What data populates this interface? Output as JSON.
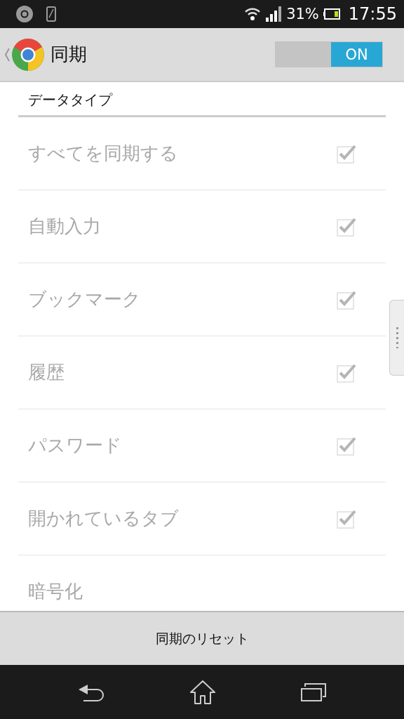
{
  "status_bar": {
    "battery_percent": "31%",
    "time": "17:55"
  },
  "action_bar": {
    "title": "同期",
    "toggle": {
      "label": "ON",
      "on": true
    }
  },
  "section_header": "データタイプ",
  "items": [
    {
      "kind": "checkbox",
      "label": "すべてを同期する",
      "checked": true,
      "disabled": true
    },
    {
      "kind": "checkbox",
      "label": "自動入力",
      "checked": true,
      "disabled": true
    },
    {
      "kind": "checkbox",
      "label": "ブックマーク",
      "checked": true,
      "disabled": true
    },
    {
      "kind": "checkbox",
      "label": "履歴",
      "checked": true,
      "disabled": true
    },
    {
      "kind": "checkbox",
      "label": "パスワード",
      "checked": true,
      "disabled": true
    },
    {
      "kind": "checkbox",
      "label": "開かれているタブ",
      "checked": true,
      "disabled": true
    },
    {
      "kind": "plain",
      "label": "暗号化",
      "disabled": true
    }
  ],
  "footer_button": "同期のリセット"
}
